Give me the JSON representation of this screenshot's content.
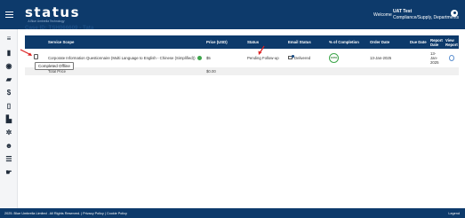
{
  "header": {
    "logo_word": "status",
    "logo_tagline": "A Blue Umbrella Technology",
    "welcome": "Welcome",
    "user_name": "UAT Test",
    "user_dept": "Compliance/Supply, Departments"
  },
  "sidebar": {
    "items": [
      {
        "name": "menu-icon",
        "glyph": "≡"
      },
      {
        "name": "bag-icon",
        "glyph": "▮"
      },
      {
        "name": "eye-icon",
        "glyph": "◉"
      },
      {
        "name": "folder-icon",
        "glyph": "▰"
      },
      {
        "name": "dollar-icon",
        "glyph": "$"
      },
      {
        "name": "document-icon",
        "glyph": "▯"
      },
      {
        "name": "chart-icon",
        "glyph": "▙"
      },
      {
        "name": "gear-icon",
        "glyph": "✲"
      },
      {
        "name": "user-add-icon",
        "glyph": "☻"
      },
      {
        "name": "list-icon",
        "glyph": "☰"
      },
      {
        "name": "hand-icon",
        "glyph": "☛"
      }
    ]
  },
  "case": {
    "title": "Case ID: TSH066609 - Tata"
  },
  "table": {
    "headers": {
      "service_scope": "Service Scope",
      "price": "Price (USD)",
      "status": "Status",
      "email_status": "Email Status",
      "completion": "% of Completion",
      "order_date": "Order Date",
      "due_date": "Due Date",
      "report_date": "Report Date",
      "view_report": "View Report"
    },
    "row": {
      "service": "Corporate Information Questionnaire (Multi Language to English - Chinese (Simplified))",
      "price": "$5",
      "status": "Pending Follow-up",
      "email_status": "Delivered",
      "completion": "100%",
      "order_date": "13-Jan-2025",
      "due_date": "",
      "report_date": "13-Jan-2025"
    },
    "total": {
      "label": "Total Price",
      "value": "$0.00"
    }
  },
  "tooltip": "Completed Offline",
  "footer": {
    "left": "2025. Blue Umbrella Limited . All Rights Reserved. | Privacy Policy | Cookie Policy",
    "right": "Legend"
  },
  "colors": {
    "navy": "#0d3a6b",
    "green": "#3da64a",
    "red": "#d22"
  }
}
